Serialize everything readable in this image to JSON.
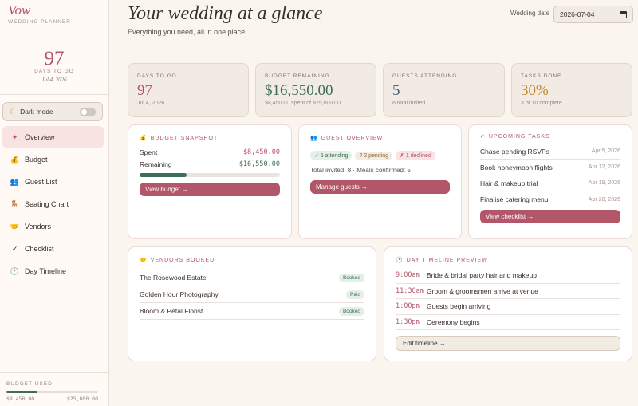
{
  "brand": {
    "name": "Vow",
    "subtitle": "WEDDING PLANNER"
  },
  "countdown": {
    "days": "97",
    "label": "DAYS TO GO",
    "date": "Jul 4, 2026"
  },
  "dark_mode": {
    "label": "Dark mode",
    "enabled": false
  },
  "nav": [
    {
      "label": "Overview",
      "icon": "sparkle-icon",
      "glyph": "✦",
      "active": true
    },
    {
      "label": "Budget",
      "icon": "money-bag-icon",
      "glyph": "💰"
    },
    {
      "label": "Guest List",
      "icon": "people-icon",
      "glyph": "👥"
    },
    {
      "label": "Seating Chart",
      "icon": "chair-icon",
      "glyph": "🪑"
    },
    {
      "label": "Vendors",
      "icon": "handshake-icon",
      "glyph": "🤝"
    },
    {
      "label": "Checklist",
      "icon": "check-icon",
      "glyph": "✓"
    },
    {
      "label": "Day Timeline",
      "icon": "clock-icon",
      "glyph": "🕐"
    }
  ],
  "budget_used": {
    "label": "BUDGET USED",
    "spent": "$8,450.00",
    "total": "$25,000.00",
    "fraction": 0.338
  },
  "header": {
    "title": "Your wedding at a glance",
    "subtitle": "Everything you need, all in one place.",
    "date_label": "Wedding date",
    "date_value": "2026-07-04"
  },
  "stats": [
    {
      "label": "DAYS TO GO",
      "value": "97",
      "sub": "Jul 4, 2026",
      "color": "#b25669"
    },
    {
      "label": "BUDGET REMAINING",
      "value": "$16,550.00",
      "sub": "$8,450.00 spent of $25,000.00",
      "color": "#3e6e55"
    },
    {
      "label": "GUESTS ATTENDING",
      "value": "5",
      "sub": "8 total invited",
      "color": "#3f5f7a"
    },
    {
      "label": "TASKS DONE",
      "value": "30%",
      "sub": "3 of 10 complete",
      "color": "#c4872e"
    }
  ],
  "budget_snapshot": {
    "title": "BUDGET SNAPSHOT",
    "spent_label": "Spent",
    "spent_value": "$8,450.00",
    "remaining_label": "Remaining",
    "remaining_value": "$16,550.00",
    "fraction": 0.338,
    "button": "View budget →"
  },
  "guest_overview": {
    "title": "GUEST OVERVIEW",
    "chips": [
      "✓ 5 attending",
      "? 2 pending",
      "✗ 1 declined"
    ],
    "summary": "Total invited: 8 · Meals confirmed: 5",
    "button": "Manage guests →"
  },
  "upcoming_tasks": {
    "title": "UPCOMING TASKS",
    "items": [
      {
        "name": "Chase pending RSVPs",
        "date": "Apr 5, 2026"
      },
      {
        "name": "Book honeymoon flights",
        "date": "Apr 12, 2026"
      },
      {
        "name": "Hair & makeup trial",
        "date": "Apr 19, 2026"
      },
      {
        "name": "Finalise catering menu",
        "date": "Apr 28, 2026"
      }
    ],
    "button": "View checklist →"
  },
  "vendors": {
    "title": "VENDORS BOOKED",
    "items": [
      {
        "name": "The Rosewood Estate",
        "status": "Booked"
      },
      {
        "name": "Golden Hour Photography",
        "status": "Paid"
      },
      {
        "name": "Bloom & Petal Florist",
        "status": "Booked"
      }
    ]
  },
  "timeline": {
    "title": "DAY TIMELINE PREVIEW",
    "items": [
      {
        "time": "9:00am",
        "event": "Bride & bridal party hair and makeup"
      },
      {
        "time": "11:30am",
        "event": "Groom & groomsmen arrive at venue"
      },
      {
        "time": "1:00pm",
        "event": "Guests begin arriving"
      },
      {
        "time": "1:30pm",
        "event": "Ceremony begins"
      }
    ],
    "button": "Edit timeline →"
  }
}
